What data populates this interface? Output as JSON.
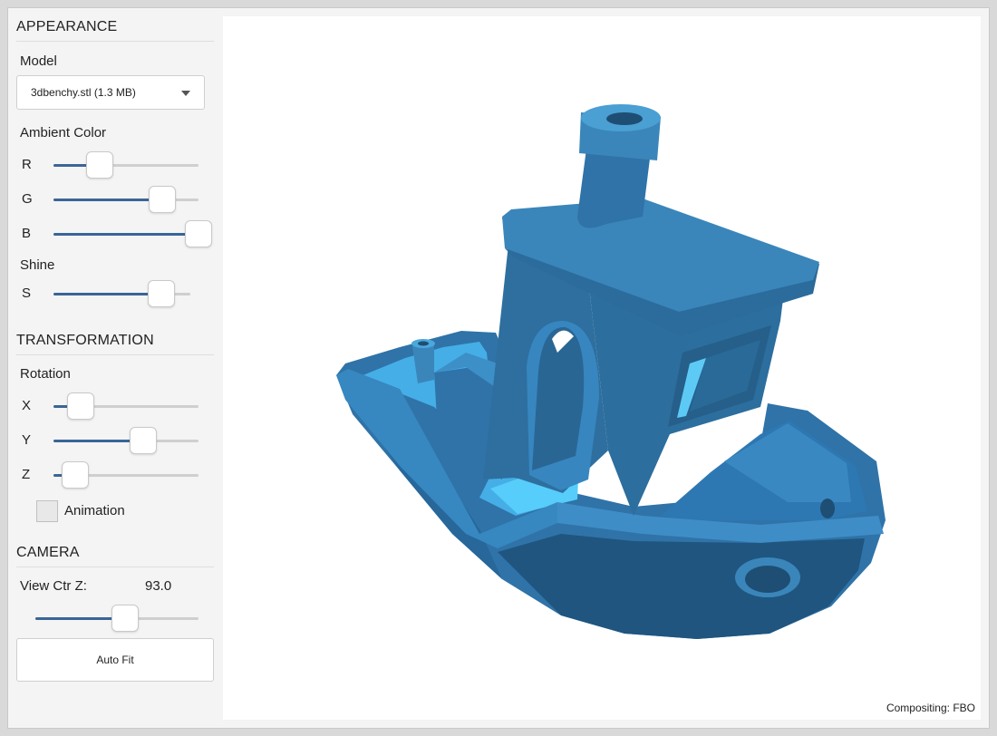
{
  "appearance": {
    "title": "APPEARANCE",
    "model_label": "Model",
    "model_value": "3dbenchy.stl (1.3 MB)",
    "ambient_label": "Ambient Color",
    "r_label": "R",
    "g_label": "G",
    "b_label": "B",
    "r_value": 0.32,
    "g_value": 0.75,
    "b_value": 1.0,
    "shine_label": "Shine",
    "s_label": "S",
    "s_value": 0.79
  },
  "transformation": {
    "title": "TRANSFORMATION",
    "rotation_label": "Rotation",
    "x_label": "X",
    "y_label": "Y",
    "z_label": "Z",
    "x_value": 0.19,
    "y_value": 0.62,
    "z_value": 0.15,
    "animation_label": "Animation",
    "animation_checked": false
  },
  "camera": {
    "title": "CAMERA",
    "view_ctr_z_label": "View Ctr Z:",
    "view_ctr_z_value": "93.0",
    "view_ctr_z_slider": 0.55,
    "auto_fit_label": "Auto Fit"
  },
  "viewport": {
    "model_color": "#3a86ba",
    "compositing_label": "Compositing: FBO"
  },
  "colors": {
    "accent": "#3a6597",
    "model_dark": "#1e4e73",
    "model_light": "#53c9f7"
  }
}
